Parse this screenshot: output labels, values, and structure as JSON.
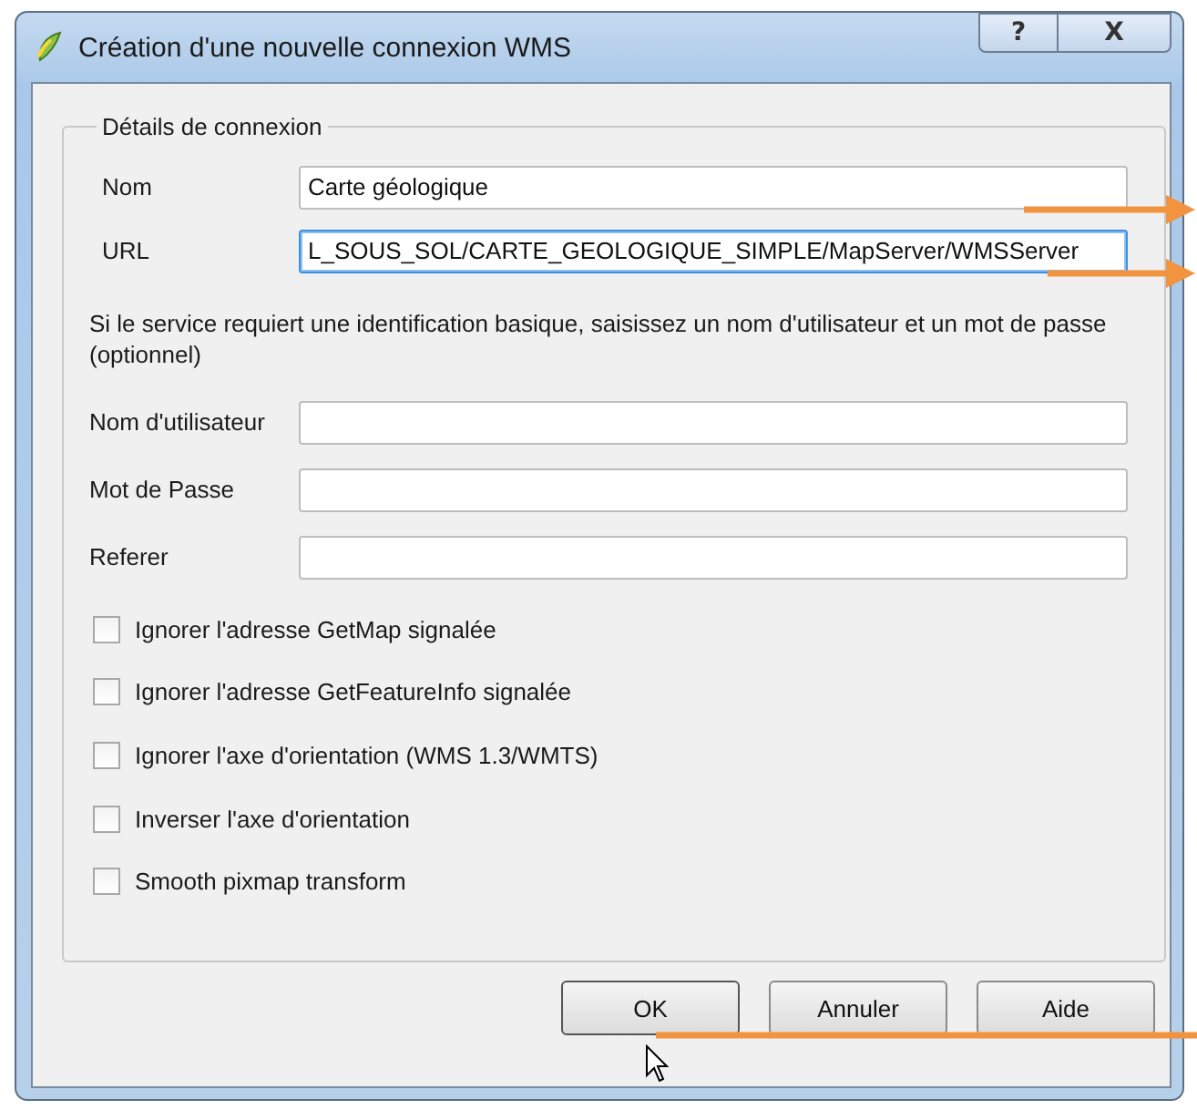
{
  "window": {
    "title": "Création d'une nouvelle connexion WMS",
    "controls": [
      "?",
      "X"
    ]
  },
  "group": {
    "title": "Détails de connexion",
    "fields": [
      {
        "label": "Nom",
        "value": "Carte géologique",
        "focused": false
      },
      {
        "label": "URL",
        "value": "L_SOUS_SOL/CARTE_GEOLOGIQUE_SIMPLE/MapServer/WMSServer",
        "focused": true
      }
    ],
    "note": "Si le service requiert une identification basique, saisissez un nom d'utilisateur et un mot de passe (optionnel)",
    "auth_fields": [
      {
        "label": "Nom d'utilisateur"
      },
      {
        "label": "Mot de Passe"
      },
      {
        "label": "Referer"
      }
    ],
    "options": [
      {
        "label": "Ignorer l'adresse GetMap signalée",
        "checked": false
      },
      {
        "label": "Ignorer l'adresse GetFeatureInfo signalée",
        "checked": false
      },
      {
        "label": "Ignorer l'axe d'orientation (WMS 1.3/WMTS)",
        "checked": false
      },
      {
        "label": "Inverser l'axe d'orientation",
        "checked": false
      },
      {
        "label": "Smooth pixmap transform",
        "checked": false
      }
    ]
  },
  "buttons": [
    {
      "label": "OK",
      "default": true
    },
    {
      "label": "Annuler",
      "default": false
    },
    {
      "label": "Aide",
      "default": false
    }
  ]
}
